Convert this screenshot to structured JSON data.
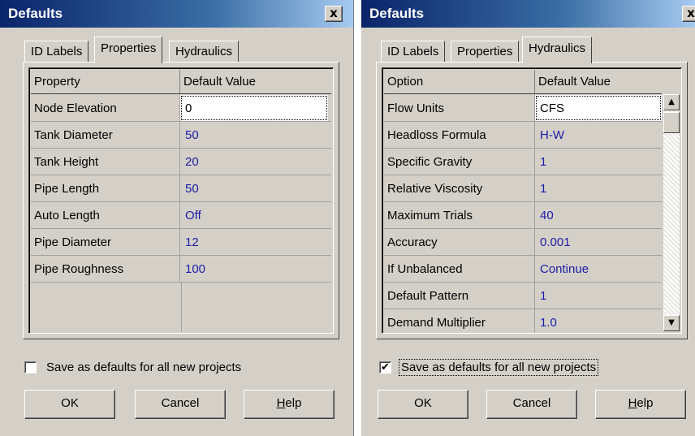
{
  "dialog1": {
    "title": "Defaults",
    "close_glyph": "x",
    "tabs": [
      {
        "label": "ID Labels",
        "active": false
      },
      {
        "label": "Properties",
        "active": true
      },
      {
        "label": "Hydraulics",
        "active": false
      }
    ],
    "grid": {
      "headers": [
        "Property",
        "Default Value"
      ],
      "rows": [
        {
          "name": "Node Elevation",
          "value": "0"
        },
        {
          "name": "Tank Diameter",
          "value": "50"
        },
        {
          "name": "Tank Height",
          "value": "20"
        },
        {
          "name": "Pipe Length",
          "value": "50"
        },
        {
          "name": "Auto Length",
          "value": "Off"
        },
        {
          "name": "Pipe Diameter",
          "value": "12"
        },
        {
          "name": "Pipe Roughness",
          "value": "100"
        }
      ]
    },
    "checkbox": {
      "label": "Save as defaults for all new projects",
      "checked": false,
      "mark": ""
    },
    "buttons": {
      "ok": "OK",
      "cancel": "Cancel",
      "help_u": "H",
      "help_rest": "elp"
    }
  },
  "dialog2": {
    "title": "Defaults",
    "close_glyph": "x",
    "tabs": [
      {
        "label": "ID Labels",
        "active": false
      },
      {
        "label": "Properties",
        "active": false
      },
      {
        "label": "Hydraulics",
        "active": true
      }
    ],
    "grid": {
      "headers": [
        "Option",
        "Default Value"
      ],
      "rows": [
        {
          "name": "Flow Units",
          "value": "CFS"
        },
        {
          "name": "Headloss Formula",
          "value": "H-W"
        },
        {
          "name": "Specific Gravity",
          "value": "1"
        },
        {
          "name": "Relative Viscosity",
          "value": "1"
        },
        {
          "name": "Maximum Trials",
          "value": "40"
        },
        {
          "name": "Accuracy",
          "value": "0.001"
        },
        {
          "name": "If Unbalanced",
          "value": "Continue"
        },
        {
          "name": "Default Pattern",
          "value": "1"
        },
        {
          "name": "Demand Multiplier",
          "value": "1.0"
        }
      ]
    },
    "checkbox": {
      "label": "Save as defaults for all new projects",
      "checked": true,
      "mark": "✔"
    },
    "buttons": {
      "ok": "OK",
      "cancel": "Cancel",
      "help_u": "H",
      "help_rest": "elp"
    }
  },
  "colors": {
    "value_text": "#1c1ca8",
    "title_bar": "#0a246a",
    "dialog_face": "#d4d0c8"
  }
}
